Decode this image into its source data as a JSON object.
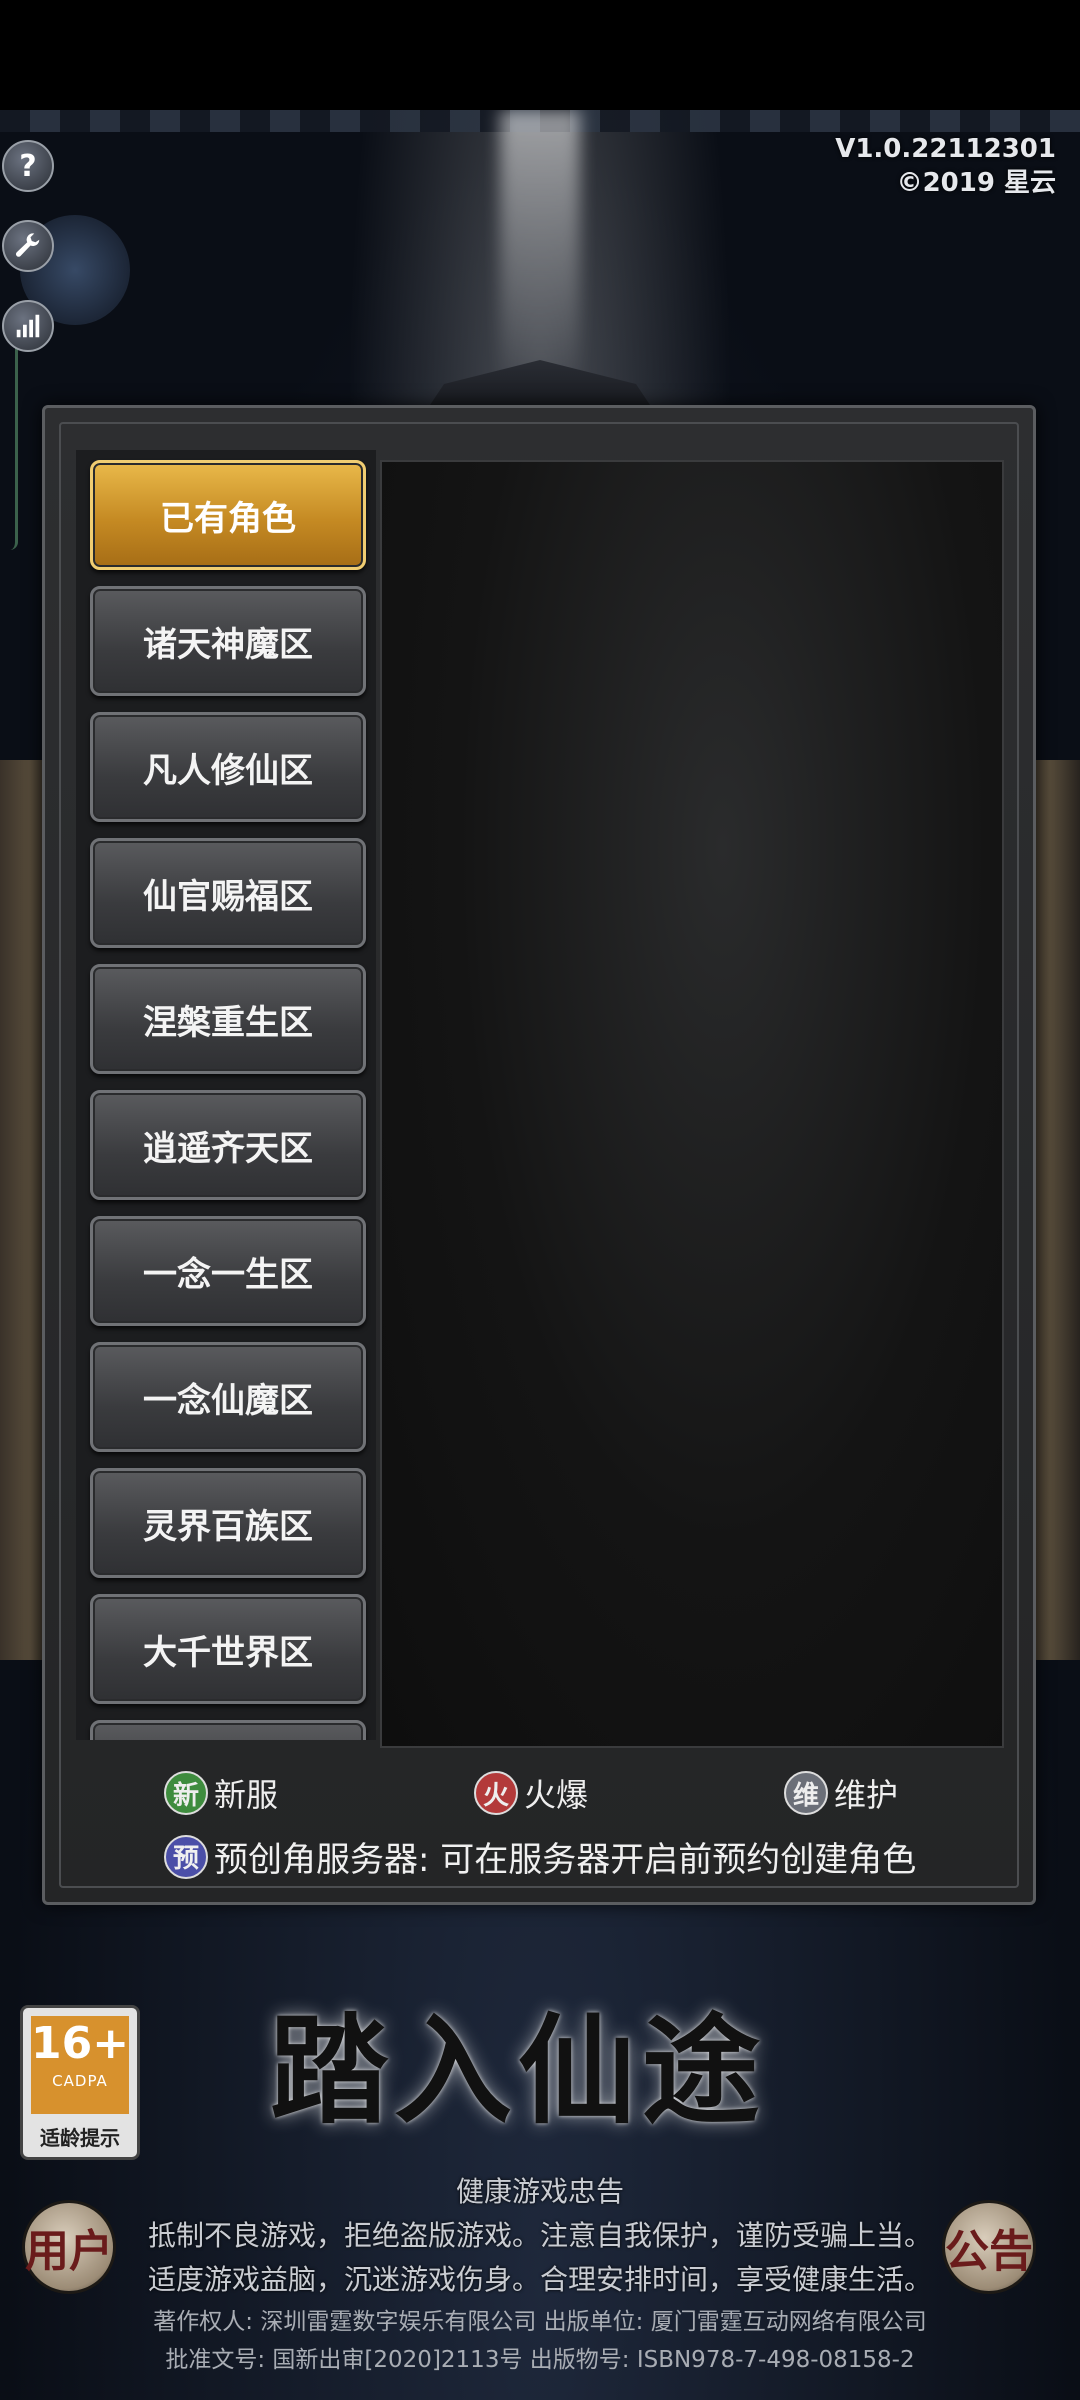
{
  "version": {
    "line1": "V1.0.22112301",
    "line2": "©2019 星云"
  },
  "side_icons": {
    "help": "?"
  },
  "server_list": {
    "items": [
      {
        "label": "已有角色",
        "active": true
      },
      {
        "label": "诸天神魔区",
        "active": false
      },
      {
        "label": "凡人修仙区",
        "active": false
      },
      {
        "label": "仙官赐福区",
        "active": false
      },
      {
        "label": "涅槃重生区",
        "active": false
      },
      {
        "label": "逍遥齐天区",
        "active": false
      },
      {
        "label": "一念一生区",
        "active": false
      },
      {
        "label": "一念仙魔区",
        "active": false
      },
      {
        "label": "灵界百族区",
        "active": false
      },
      {
        "label": "大千世界区",
        "active": false
      }
    ]
  },
  "legend": {
    "new": {
      "badge": "新",
      "label": "新服",
      "color": "#3e8c3e"
    },
    "hot": {
      "badge": "火",
      "label": "火爆",
      "color": "#b33a3a"
    },
    "maintain": {
      "badge": "维",
      "label": "维护",
      "color": "#6b6f78"
    },
    "prebook": {
      "badge": "预",
      "text": "预创角服务器: 可在服务器开启前预约创建角色",
      "color": "#4b4fa8"
    }
  },
  "age_rating": {
    "number": "16+",
    "org": "CADPA",
    "label": "适龄提示"
  },
  "title": "踏入仙途",
  "round_buttons": {
    "left": "用户",
    "right": "公告"
  },
  "health_notice": {
    "heading": "健康游戏忠告",
    "line1": "抵制不良游戏，拒绝盗版游戏。注意自我保护，谨防受骗上当。",
    "line2": "适度游戏益脑，沉迷游戏伤身。合理安排时间，享受健康生活。"
  },
  "copyright": {
    "line1": "著作权人: 深圳雷霆数字娱乐有限公司 出版单位: 厦门雷霆互动网络有限公司",
    "line2": "批准文号: 国新出审[2020]2113号 出版物号: ISBN978-7-498-08158-2"
  },
  "colors": {
    "active_button": "#c58a23",
    "panel": "#2d2e30"
  }
}
